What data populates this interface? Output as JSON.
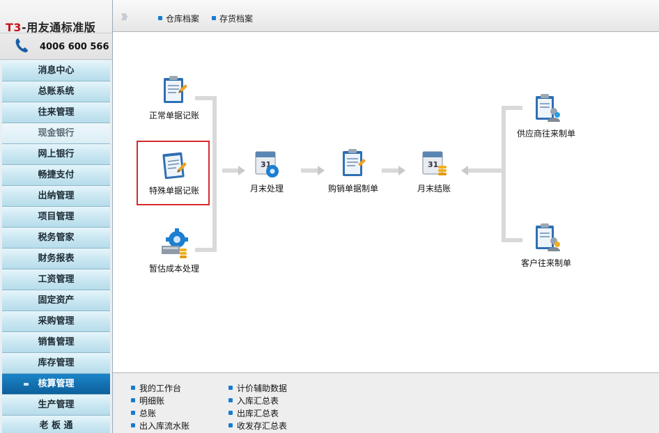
{
  "brand": {
    "prefix": "T3",
    "title": "-用友通标准版",
    "phone": "4006 600 566"
  },
  "sidebar": {
    "items": [
      {
        "label": "消息中心"
      },
      {
        "label": "总账系统"
      },
      {
        "label": "往来管理"
      },
      {
        "label": "现金银行"
      },
      {
        "label": "网上银行"
      },
      {
        "label": "畅捷支付"
      },
      {
        "label": "出纳管理"
      },
      {
        "label": "项目管理"
      },
      {
        "label": "税务管家"
      },
      {
        "label": "财务报表"
      },
      {
        "label": "工资管理"
      },
      {
        "label": "固定资产"
      },
      {
        "label": "采购管理"
      },
      {
        "label": "销售管理"
      },
      {
        "label": "库存管理"
      },
      {
        "label": "核算管理"
      },
      {
        "label": "生产管理"
      },
      {
        "label": "老 板 通"
      }
    ],
    "active_index": 15
  },
  "toolbar": {
    "chevron": "》》",
    "links": [
      "仓库档案",
      "存货档案"
    ]
  },
  "flow": {
    "normal_posting": "正常单据记账",
    "special_posting": "特殊单据记账",
    "estimated_cost": "暂估成本处理",
    "month_end_processing": "月末处理",
    "purchase_sales_voucher": "购销单据制单",
    "month_end_closing": "月末结账",
    "supplier_voucher": "供应商往来制单",
    "customer_voucher": "客户往来制单"
  },
  "bottom_links": {
    "col1": [
      "我的工作台",
      "明细账",
      "总账",
      "出入库流水账"
    ],
    "col2": [
      "计价辅助数据",
      "入库汇总表",
      "出库汇总表",
      "收发存汇总表"
    ]
  },
  "icons": {
    "clipboard": "clipboard-pencil-icon",
    "calendar": "calendar-gear-icon",
    "calendar_coins": "calendar-coins-icon",
    "gear_cost": "gear-cost-icon",
    "clipboard_user": "clipboard-user-icon",
    "phone": "phone-icon"
  },
  "colors": {
    "accent": "#1a7bd0",
    "active_nav": "#1180c4",
    "highlight_border": "#d8292a"
  }
}
